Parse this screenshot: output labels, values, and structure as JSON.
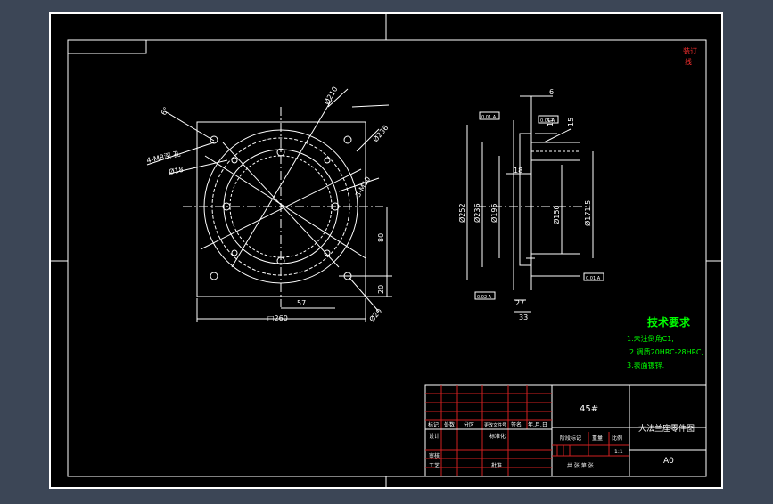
{
  "drawing": {
    "top_right_mark": "装订",
    "top_right_mark2": "线",
    "front_view": {
      "dims": {
        "d210": "Ø210",
        "d236": "Ø236",
        "angle6": "6°",
        "holes": "4-M8深 孔",
        "d18": "Ø18",
        "m10": "3-M10",
        "dim80": "80",
        "dim20": "20",
        "dim57": "57",
        "dim260": "□260",
        "d20": "Ø20"
      }
    },
    "section_view": {
      "dims": {
        "dim6": "6",
        "dim10": "10",
        "dim15": "15",
        "dim18": "18",
        "d195": "Ø195",
        "d150": "Ø150",
        "d171": "Ø171.5",
        "d236s": "Ø236",
        "d252": "Ø252",
        "dim27": "27",
        "dim33": "33"
      },
      "tolerance_frames": [
        "0.01 A",
        "0.01 A",
        "0.02 A",
        "0.01 A"
      ]
    },
    "tech_requirements": {
      "title": "技术要求",
      "items": [
        "1.未注倒角C1,",
        "2.调质20HRC-28HRC,",
        "3.表面镀锌."
      ]
    },
    "title_block": {
      "material": "45#",
      "part_name": "大法兰座零件图",
      "size": "A0",
      "scale": "1:1",
      "row_labels": [
        "标记",
        "处数",
        "分区",
        "更改文件号",
        "签名",
        "年.月.日"
      ],
      "design": "设计",
      "standardize": "标准化",
      "review": "审核",
      "process": "工艺",
      "approve": "批准",
      "stage_mark": "阶段标记",
      "weight": "重量",
      "ratio": "比例",
      "sheet": "共  张 第  张"
    }
  }
}
